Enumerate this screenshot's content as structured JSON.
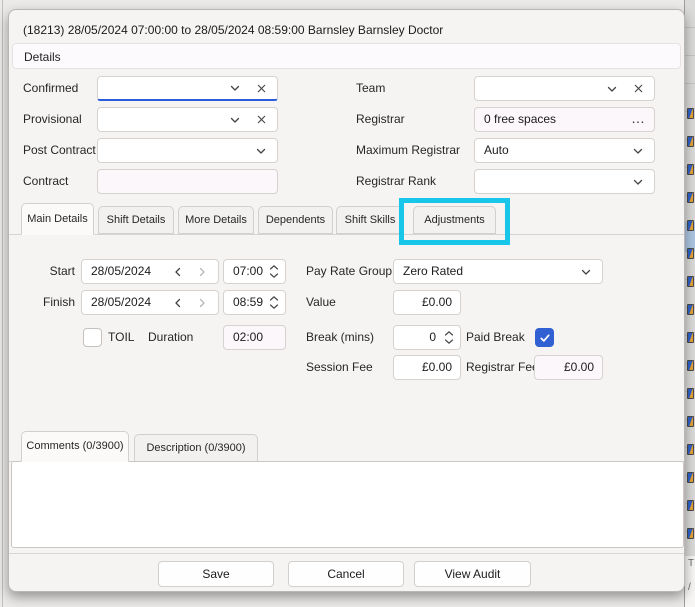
{
  "window": {
    "title": "(18213) 28/05/2024 07:00:00 to 28/05/2024 08:59:00 Barnsley Barnsley Doctor",
    "details_header": "Details"
  },
  "details_form": {
    "confirmed": {
      "label": "Confirmed",
      "value": ""
    },
    "provisional": {
      "label": "Provisional",
      "value": ""
    },
    "post_contract": {
      "label": "Post Contract",
      "value": ""
    },
    "contract": {
      "label": "Contract",
      "value": ""
    },
    "team": {
      "label": "Team",
      "value": ""
    },
    "registrar": {
      "label": "Registrar",
      "value": "0 free spaces"
    },
    "maximum_registrar": {
      "label": "Maximum Registrar",
      "value": "Auto"
    },
    "registrar_rank": {
      "label": "Registrar Rank",
      "value": ""
    }
  },
  "tabs": [
    {
      "label": "Main Details",
      "active": true
    },
    {
      "label": "Shift Details",
      "active": false
    },
    {
      "label": "More Details",
      "active": false
    },
    {
      "label": "Dependents",
      "active": false
    },
    {
      "label": "Shift Skills",
      "active": false
    },
    {
      "label": "Adjustments",
      "active": false,
      "highlighted": true
    }
  ],
  "main_details": {
    "start": {
      "label": "Start",
      "date": "28/05/2024",
      "time": "07:00"
    },
    "finish": {
      "label": "Finish",
      "date": "28/05/2024",
      "time": "08:59"
    },
    "toil": {
      "label": "TOIL",
      "checked": false
    },
    "duration": {
      "label": "Duration",
      "value": "02:00"
    },
    "pay_rate_group": {
      "label": "Pay Rate Group",
      "required": "*",
      "value": "Zero Rated"
    },
    "value": {
      "label": "Value",
      "value": "£0.00"
    },
    "break_mins": {
      "label": "Break (mins)",
      "value": "0"
    },
    "paid_break": {
      "label": "Paid Break",
      "checked": true
    },
    "session_fee": {
      "label": "Session Fee",
      "value": "£0.00"
    },
    "registrar_fee": {
      "label": "Registrar Fee",
      "value": "£0.00"
    }
  },
  "notes_tabs": {
    "comments": "Comments (0/3900)",
    "description": "Description (0/3900)"
  },
  "comments_text": "",
  "buttons": {
    "save": "Save",
    "cancel": "Cancel",
    "view_audit": "View Audit"
  },
  "icons": {
    "more": "…"
  },
  "colors": {
    "focus_blue": "#2b5cd9",
    "checkbox_blue": "#3160d3",
    "highlight_cyan": "#17c6e9",
    "required_red": "#d83b3b"
  },
  "background": {
    "fragments": [
      "T",
      "/"
    ]
  }
}
